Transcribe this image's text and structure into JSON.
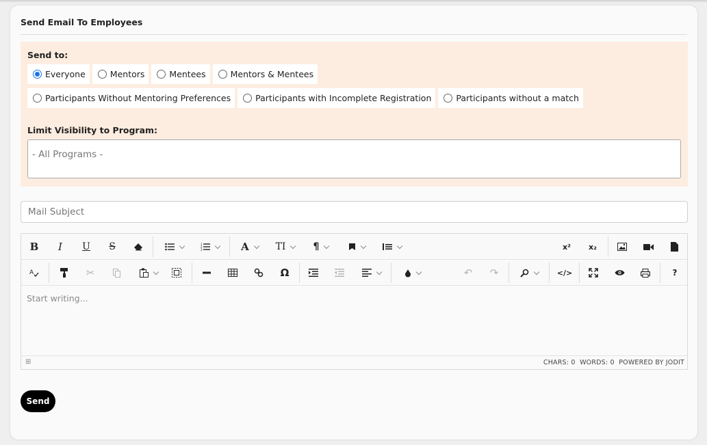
{
  "card": {
    "title": "Send Email To Employees"
  },
  "send_to": {
    "label": "Send to:",
    "row1": [
      {
        "label": "Everyone",
        "checked": true
      },
      {
        "label": "Mentors",
        "checked": false
      },
      {
        "label": "Mentees",
        "checked": false
      },
      {
        "label": "Mentors & Mentees",
        "checked": false
      }
    ],
    "row2": [
      {
        "label": "Participants Without Mentoring Preferences",
        "checked": false
      },
      {
        "label": "Participants with Incomplete Registration",
        "checked": false
      },
      {
        "label": "Participants without a match",
        "checked": false
      }
    ]
  },
  "visibility": {
    "label": "Limit Visibility to Program:",
    "selected": "- All Programs -"
  },
  "subject": {
    "placeholder": "Mail Subject"
  },
  "editor": {
    "placeholder": "Start writing...",
    "toolbar": {
      "bold": "B",
      "italic": "I",
      "underline": "U",
      "strike": "S",
      "font": "A",
      "fontsize": "TI",
      "paragraph": "¶",
      "superscript": "x²",
      "subscript": "x₂",
      "special_char": "Ω",
      "help": "?"
    },
    "status": {
      "chars": "CHARS: 0",
      "words": "WORDS: 0",
      "powered": "POWERED BY JODIT"
    }
  },
  "actions": {
    "send_label": "Send"
  },
  "colors": {
    "accent": "#1a73e8",
    "panel_bg": "#fdede0",
    "send_bg": "#000000"
  }
}
